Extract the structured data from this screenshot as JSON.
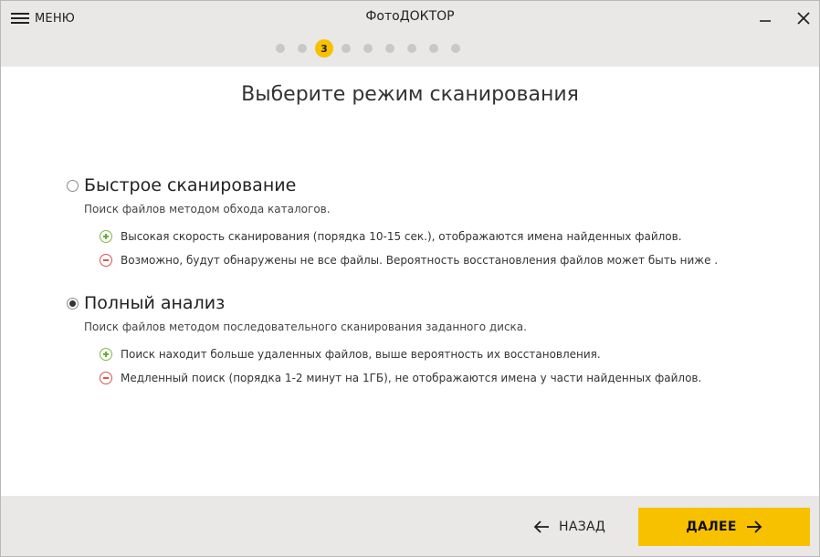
{
  "header": {
    "menu_label": "МЕНЮ",
    "app_title": "ФотоДОКТОР",
    "steps": {
      "total": 9,
      "current": 3,
      "current_label": "3"
    }
  },
  "main": {
    "page_title": "Выберите режим сканирования",
    "options": [
      {
        "title": "Быстрое сканирование",
        "selected": false,
        "description": "Поиск файлов методом обхода каталогов.",
        "pros": "Высокая скорость сканирования (порядка 10-15 сек.),  отображаются имена найденных  файлов.",
        "cons": "Возможно, будут обнаружены не все файлы. Вероятность восстановления файлов может быть ниже ."
      },
      {
        "title": "Полный анализ",
        "selected": true,
        "description": "Поиск файлов методом последовательного сканирования заданного диска.",
        "pros": "Поиск находит больше удаленных файлов,  выше вероятность их восстановления.",
        "cons": "Медленный поиск  (порядка 1-2 минут на 1ГБ), не отображаются имена у части найденных файлов."
      }
    ]
  },
  "footer": {
    "back_label": "НАЗАД",
    "next_label": "ДАЛЕЕ"
  },
  "colors": {
    "accent": "#f8c100",
    "header_bg": "#e9e8e6",
    "plus": "#6aa83a",
    "minus": "#d9534f"
  }
}
